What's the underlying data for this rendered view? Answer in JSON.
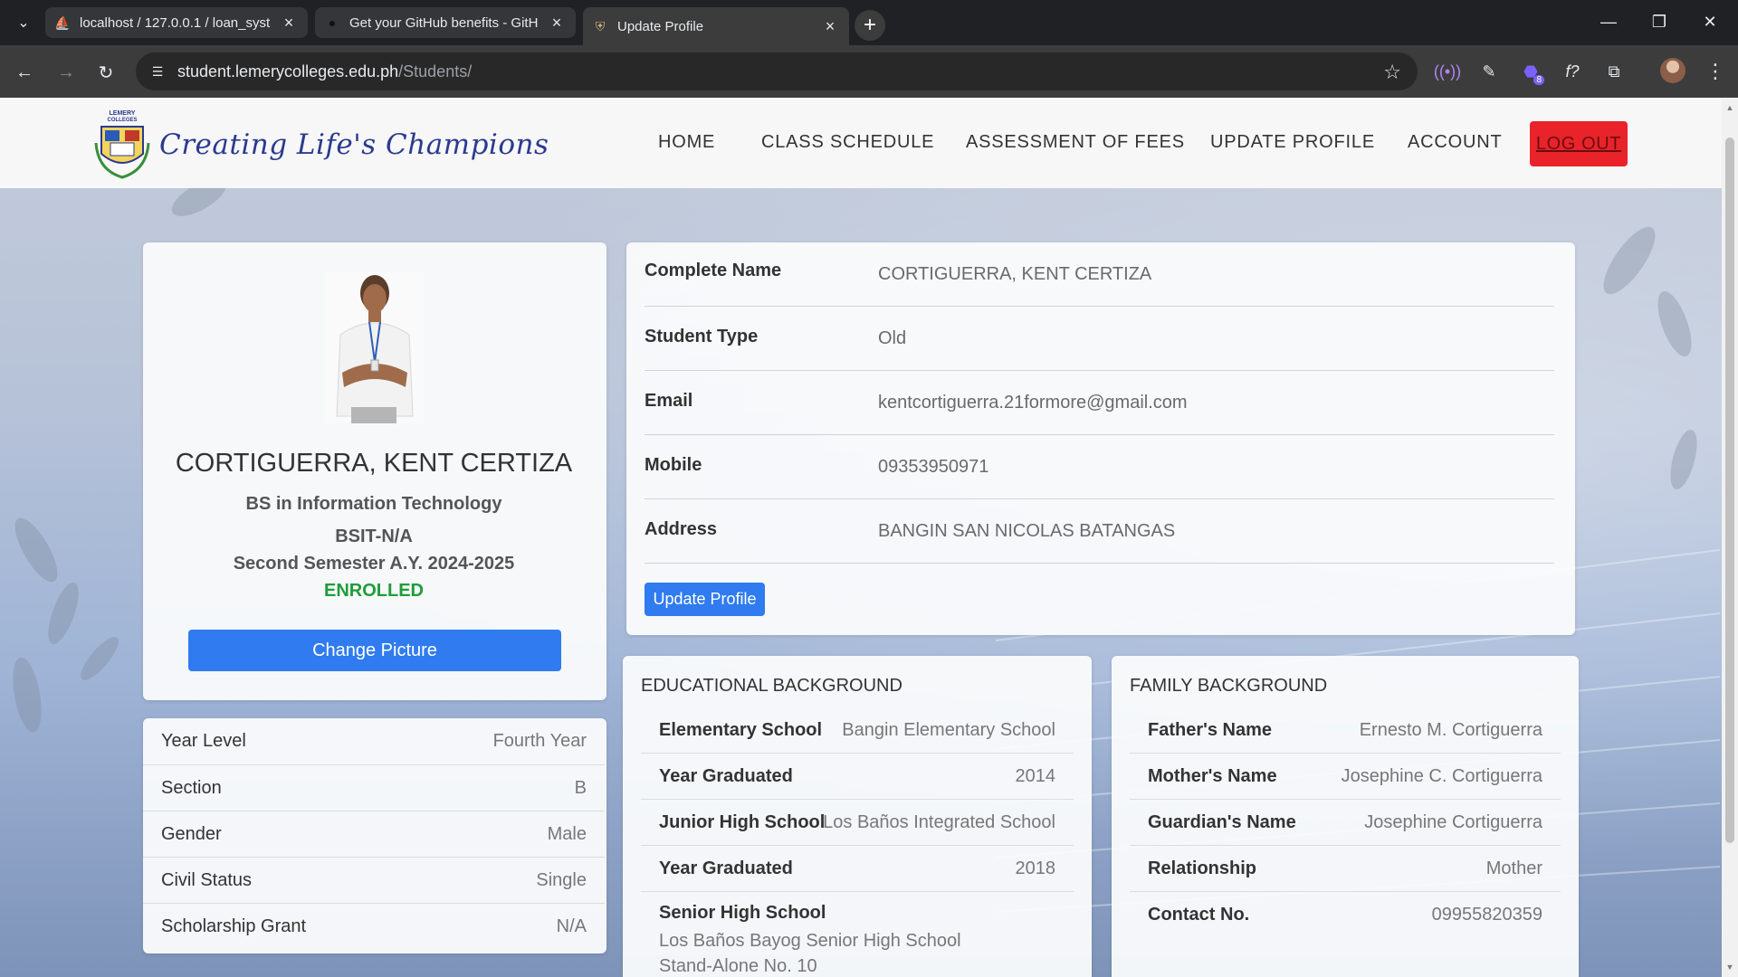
{
  "browser": {
    "tabs": [
      {
        "title": "localhost / 127.0.0.1 / loan_syst",
        "icon": "phpmyadmin-icon"
      },
      {
        "title": "Get your GitHub benefits - GitH",
        "icon": "github-icon"
      },
      {
        "title": "Update Profile",
        "icon": "school-seal-icon"
      }
    ],
    "url_host": "student.lemerycolleges.edu.ph",
    "url_path": "/Students/",
    "extension_badge": "8"
  },
  "site": {
    "logo_text_top": "LEMERY COLLEGES",
    "tagline": "Creating Life's Champions",
    "nav": [
      "HOME",
      "CLASS SCHEDULE",
      "ASSESSMENT OF FEES",
      "UPDATE PROFILE",
      "ACCOUNT"
    ],
    "logout_label": "LOG OUT",
    "accent_color": "#2f7bef",
    "logout_color": "#e8232a"
  },
  "profile": {
    "name": "CORTIGUERRA, KENT CERTIZA",
    "program": "BS in Information Technology",
    "section_code": "BSIT-N/A",
    "semester": "Second Semester A.Y. 2024-2025",
    "status": "ENROLLED",
    "change_picture_label": "Change Picture",
    "info": [
      {
        "label": "Year Level",
        "value": "Fourth Year"
      },
      {
        "label": "Section",
        "value": "B"
      },
      {
        "label": "Gender",
        "value": "Male"
      },
      {
        "label": "Civil Status",
        "value": "Single"
      },
      {
        "label": "Scholarship Grant",
        "value": "N/A"
      }
    ]
  },
  "details": {
    "rows": [
      {
        "label": "Complete Name",
        "value": "CORTIGUERRA, KENT CERTIZA"
      },
      {
        "label": "Student Type",
        "value": "Old"
      },
      {
        "label": "Email",
        "value": "kentcortiguerra.21formore@gmail.com"
      },
      {
        "label": "Mobile",
        "value": "09353950971"
      },
      {
        "label": "Address",
        "value": "BANGIN SAN NICOLAS BATANGAS"
      }
    ],
    "update_label": "Update Profile"
  },
  "education": {
    "title": "EDUCATIONAL BACKGROUND",
    "rows": [
      {
        "label": "Elementary School",
        "value": "Bangin Elementary School"
      },
      {
        "label": "Year Graduated",
        "value": "2014"
      },
      {
        "label": "Junior High School",
        "value": "Los Baños Integrated School"
      },
      {
        "label": "Year Graduated",
        "value": "2018"
      }
    ],
    "senior_label": "Senior High School",
    "senior_value": "Los Baños Bayog Senior High School Stand-Alone No. 10"
  },
  "family": {
    "title": "FAMILY BACKGROUND",
    "rows": [
      {
        "label": "Father's Name",
        "value": "Ernesto M. Cortiguerra"
      },
      {
        "label": "Mother's Name",
        "value": "Josephine C. Cortiguerra"
      },
      {
        "label": "Guardian's Name",
        "value": "Josephine Cortiguerra"
      },
      {
        "label": "Relationship",
        "value": "Mother"
      },
      {
        "label": "Contact No.",
        "value": "09955820359"
      }
    ]
  }
}
